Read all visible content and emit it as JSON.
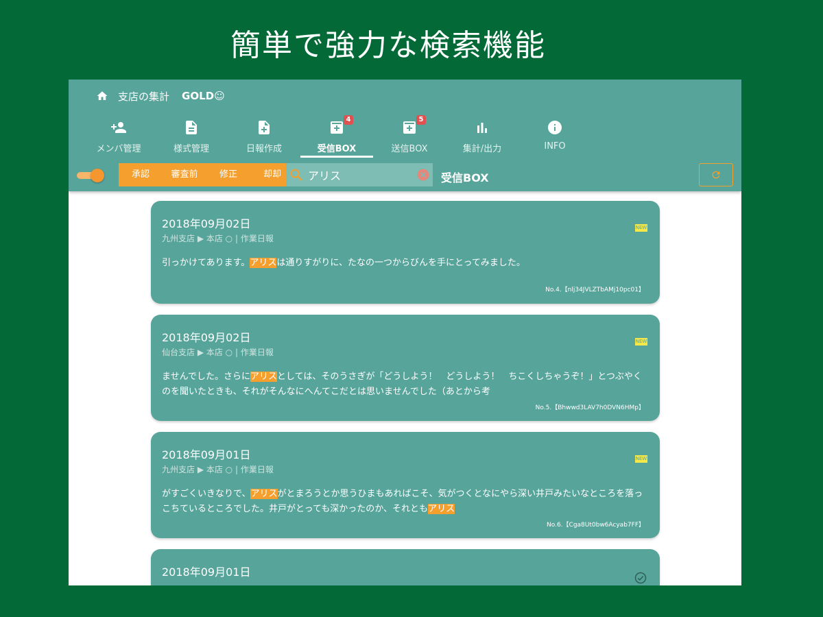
{
  "headline": "簡単で強力な検索機能",
  "topbar": {
    "title": "支店の集計",
    "plan": "GOLD☺"
  },
  "tabs": [
    {
      "label": "メンバ管理",
      "icon": "person-add-icon",
      "badge": ""
    },
    {
      "label": "様式管理",
      "icon": "document-icon",
      "badge": ""
    },
    {
      "label": "日報作成",
      "icon": "note-add-icon",
      "badge": ""
    },
    {
      "label": "受信BOX",
      "icon": "inbox-icon",
      "badge": "4"
    },
    {
      "label": "送信BOX",
      "icon": "outbox-icon",
      "badge": "5"
    },
    {
      "label": "集計/出力",
      "icon": "bar-chart-icon",
      "badge": ""
    },
    {
      "label": "INFO",
      "icon": "info-icon",
      "badge": ""
    }
  ],
  "active_tab": "受信BOX",
  "filters": [
    "承認",
    "審査前",
    "修正",
    "却却"
  ],
  "search": {
    "value": "アリス",
    "placeholder": ""
  },
  "box_title": "受信BOX",
  "colors": {
    "background": "#036a37",
    "primary": "#56a49a",
    "accent": "#f5a02e",
    "new_badge": "#f7e84a"
  },
  "cards": [
    {
      "date": "2018年09月02日",
      "meta": "九州支店 ▶ 本店 ○ | 作業日報",
      "status": "new",
      "new_label": "NEW",
      "body_before": "引っかけてあります。",
      "highlight": "アリス",
      "body_after": "は通りすがりに、たなの一つからびんを手にとってみました。",
      "body_after2": "",
      "highlight2": "",
      "ref": "No.4.【nlj34JVLZTbAMj10pc01】"
    },
    {
      "date": "2018年09月02日",
      "meta": "仙台支店 ▶ 本店 ○ | 作業日報",
      "status": "new",
      "new_label": "NEW",
      "body_before": "ませんでした。さらに",
      "highlight": "アリス",
      "body_after": "としては、そのうさぎが「どうしよう！　どうしよう！　ちこくしちゃうぞ！」とつぶやくのを聞いたときも、それがそんなにへんてこだとは思いませんでした（あとから考",
      "body_after2": "",
      "highlight2": "",
      "ref": "No.5.【Bhwwd3LAV7h0DVN6HMp】"
    },
    {
      "date": "2018年09月01日",
      "meta": "九州支店 ▶ 本店 ○ | 作業日報",
      "status": "new",
      "new_label": "NEW",
      "body_before": "がすごくいきなりで、",
      "highlight": "アリス",
      "body_after": "がとまろうとか思うひまもあればこそ、気がつくとなにやら深い井戸みたいなところを落っこちているところでした。井戸がとっても深かったのか、それとも",
      "body_after2": "",
      "highlight2": "アリス",
      "ref": "No.6.【Cga8Ut0bw6Acyab7FF】"
    },
    {
      "date": "2018年09月01日",
      "meta": "",
      "status": "checked",
      "new_label": "",
      "body_before": "",
      "highlight": "",
      "body_after": "",
      "body_after2": "",
      "highlight2": "",
      "ref": ""
    }
  ]
}
